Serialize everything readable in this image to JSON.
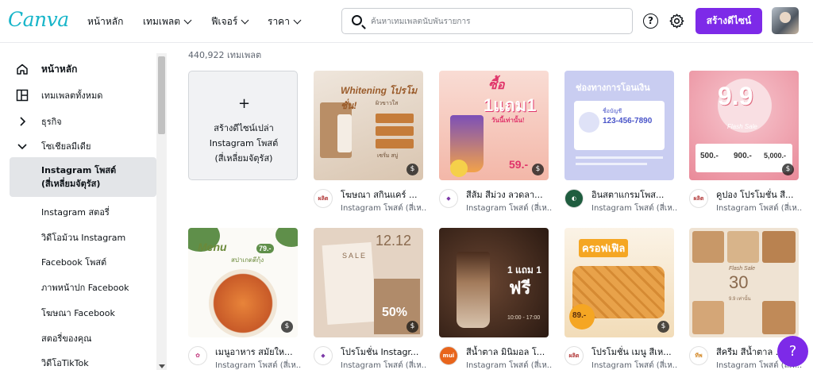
{
  "header": {
    "logo": "Canva",
    "nav": [
      {
        "label": "หน้าหลัก",
        "dropdown": false
      },
      {
        "label": "เทมเพลต",
        "dropdown": true
      },
      {
        "label": "ฟีเจอร์",
        "dropdown": true
      },
      {
        "label": "ราคา",
        "dropdown": true
      }
    ],
    "search_placeholder": "ค้นหาเทมเพลตนับพันรายการ",
    "help_icon": "?",
    "create_label": "สร้างดีไซน์"
  },
  "sidebar": {
    "items": [
      {
        "label": "หน้าหลัก",
        "icon": "home-icon"
      },
      {
        "label": "เทมเพลตทั้งหมด",
        "icon": "layout-icon"
      },
      {
        "label": "ธุรกิจ",
        "icon": "chevron-right-icon"
      },
      {
        "label": "โซเชียลมีเดีย",
        "icon": "chevron-down-icon"
      }
    ],
    "active_sub": "Instagram โพสต์\n(สี่เหลี่ยมจัตุรัส)",
    "subs": [
      "Instagram สตอรี่",
      "วิดีโอม้วน Instagram",
      "Facebook โพสต์",
      "ภาพหน้าปก Facebook",
      "โฆษณา Facebook",
      "สตอรี่ของคุณ",
      "วิดีโอTikTok"
    ]
  },
  "main": {
    "count": "440,922 เทมเพลต",
    "blank": {
      "plus": "+",
      "label": "สร้างดีไซน์เปล่า\nInstagram โพสต์\n(สี่เหลี่ยมจัตุรัส)"
    },
    "templates": [
      {
        "title": "โฆษณา สกินแคร์ ...",
        "sub": "Instagram โพสต์ (สี่เห...",
        "logo": "ผลิต",
        "logo_color": "#b23a3a",
        "texts": {
          "a": "Whitening โปรโมชั่น!",
          "b": "ผิวขาวใส",
          "c": "เซรั่ม สบู่"
        }
      },
      {
        "title": "สีส้ม สีม่วง ลวดลา...",
        "sub": "Instagram โพสต์ (สี่เห...",
        "logo": "◆",
        "logo_color": "#7d3aa8",
        "texts": {
          "a": "ซื้อ",
          "b": "1แถม1",
          "c": "วันนี้เท่านั้น!",
          "d": "59.-"
        }
      },
      {
        "title": "อินสตาแกรมโพส...",
        "sub": "Instagram โพสต์ (สี่เห...",
        "logo": "◐",
        "logo_color": "#1f5d3f",
        "texts": {
          "a": "ช่องทางการโอนเงิน",
          "b": "123-456-7890",
          "c": "ชื่อบัญชี"
        }
      },
      {
        "title": "คูปอง โปรโมชั่น สี...",
        "sub": "Instagram โพสต์ (สี่เห...",
        "logo": "ผลิต",
        "logo_color": "#b23a3a",
        "texts": {
          "a": "9.9",
          "b": "Flash Sale",
          "c1": "500.-",
          "c2": "900.-",
          "c3": "5,000.-"
        }
      },
      {
        "title": "เมนูอาหาร สมัยให...",
        "sub": "Instagram โพสต์ (สี่เห...",
        "logo": "✿",
        "logo_color": "#c0347a",
        "texts": {
          "a": "Menu",
          "b": "สปาเกตตีกุ้ง",
          "c": "79.-"
        }
      },
      {
        "title": "โปรโมชั่น Instagr...",
        "sub": "Instagram โพสต์ (สี่เห...",
        "logo": "◆",
        "logo_color": "#7d3aa8",
        "texts": {
          "a": "12.12",
          "b": "SALE",
          "c": "50%"
        }
      },
      {
        "title": "สีน้ำตาล มินิมอล โ...",
        "sub": "Instagram โพสต์ (สี่เห...",
        "logo": "mui",
        "logo_color": "#e8651c",
        "texts": {
          "a": "1 แถม 1",
          "b": "ฟรี",
          "c": "10:00 - 17:00"
        }
      },
      {
        "title": "โปรโมชั่น เมนู สีเห...",
        "sub": "Instagram โพสต์ (สี่เห...",
        "logo": "ผลิต",
        "logo_color": "#b23a3a",
        "texts": {
          "a": "ครอฟเฟิล",
          "b": "89.-"
        }
      },
      {
        "title": "สีครีม สีน้ำตาล ...",
        "sub": "Instagram โพสต์ (สี่เห...",
        "logo": "ทีพ",
        "logo_color": "#d48a2a",
        "texts": {
          "a": "Flash Sale",
          "b": "30",
          "c": "9.9 เท่านั้น"
        }
      }
    ]
  },
  "fab": "?",
  "colors": {
    "accent": "#7d2ae8",
    "logo": "#17b5c9"
  }
}
